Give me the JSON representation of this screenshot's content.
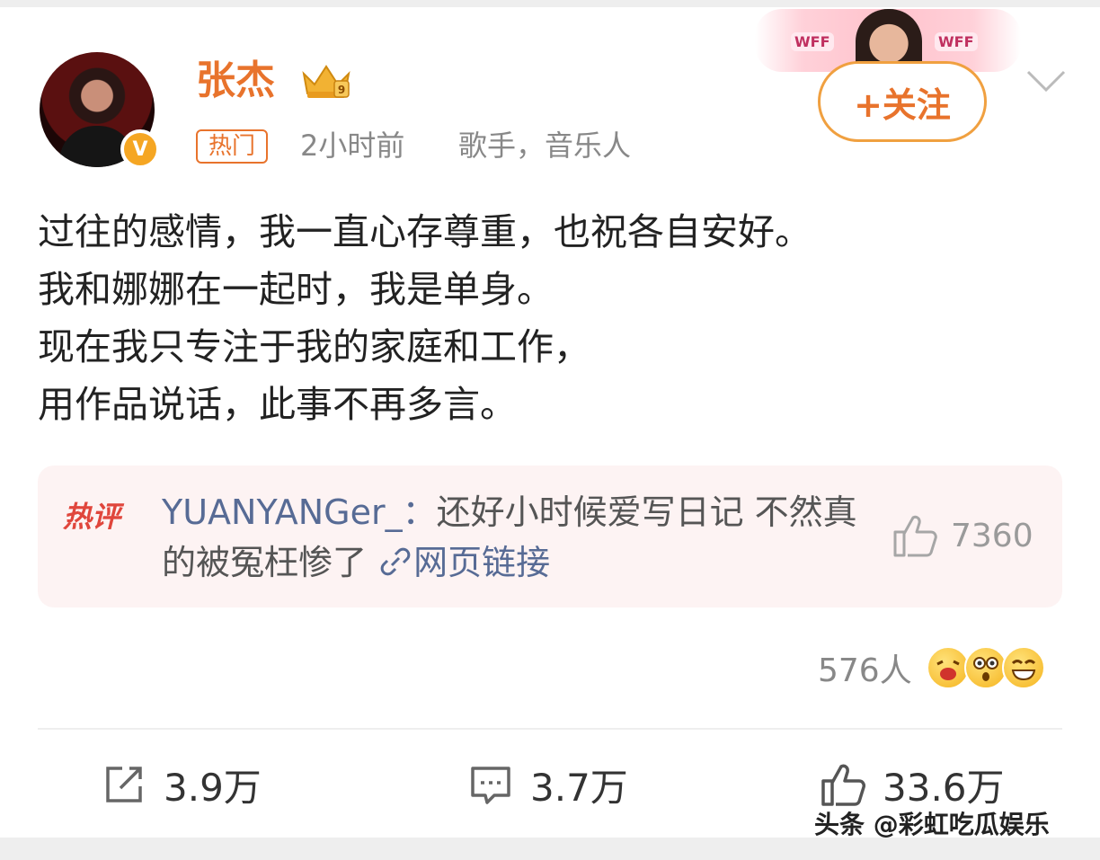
{
  "post": {
    "author": "张杰",
    "hot_tag": "热门",
    "time": "2小时前",
    "role": "歌手，音乐人",
    "follow_label": "+关注",
    "banner_text": "WFF",
    "lines": [
      "过往的感情，我一直心存尊重，也祝各自安好。",
      "我和娜娜在一起时，我是单身。",
      "现在我只专注于我的家庭和工作，",
      "用作品说话，此事不再多言。"
    ]
  },
  "hot_comment": {
    "label": "热评",
    "user": "YUANYANGer_：",
    "text": "还好小时候爱写日记 不然真的被冤枉惨了",
    "link_text": "网页链接",
    "like_count": "7360"
  },
  "reactions": {
    "count": "576人"
  },
  "actions": {
    "repost_count": "3.9万",
    "comment_count": "3.7万",
    "like_count": "33.6万"
  },
  "watermark": "头条 @彩虹吃瓜娱乐",
  "colors": {
    "accent": "#e8732c",
    "link": "#576b95",
    "hot_red": "#e0463c"
  },
  "icons": [
    "verified-v-icon",
    "crown-badge-icon",
    "chevron-down-icon",
    "link-icon",
    "thumbs-up-icon",
    "repost-icon",
    "comment-icon",
    "like-icon"
  ]
}
